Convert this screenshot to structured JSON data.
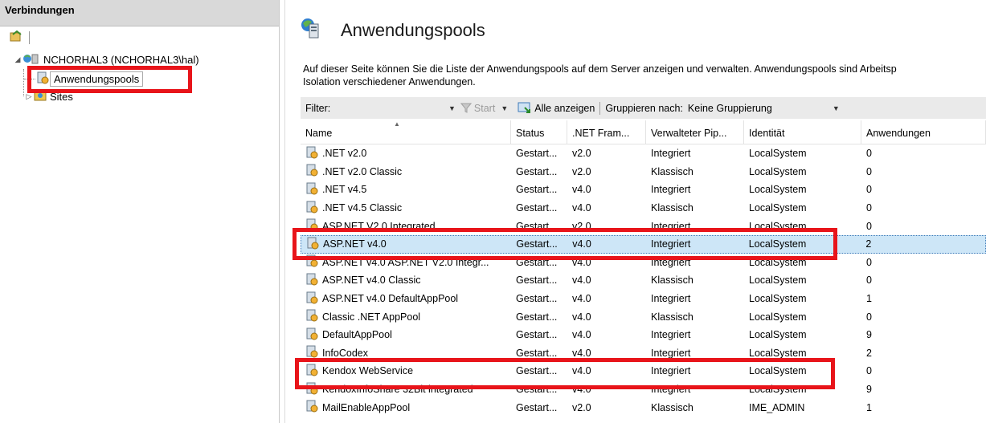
{
  "connections": {
    "header": "Verbindungen",
    "tree": {
      "server_label": "NCHORHAL3 (NCHORHAL3\\hal)",
      "app_pools_label": "Anwendungspools",
      "sites_label": "Sites"
    }
  },
  "page": {
    "title": "Anwendungspools",
    "description": "Auf dieser Seite können Sie die Liste der Anwendungspools auf dem Server anzeigen und verwalten. Anwendungspools sind Arbeitsp\nIsolation verschiedener Anwendungen."
  },
  "filterbar": {
    "filter_label": "Filter:",
    "start_label": "Start",
    "show_all_label": "Alle anzeigen",
    "group_by_label": "Gruppieren nach:",
    "group_by_value": "Keine Gruppierung"
  },
  "grid": {
    "columns": [
      "Name",
      "Status",
      ".NET Fram...",
      "Verwalteter Pip...",
      "Identität",
      "Anwendungen"
    ],
    "rows": [
      {
        "name": ".NET v2.0",
        "status": "Gestart...",
        "net": "v2.0",
        "pipeline": "Integriert",
        "identity": "LocalSystem",
        "apps": "0"
      },
      {
        "name": ".NET v2.0 Classic",
        "status": "Gestart...",
        "net": "v2.0",
        "pipeline": "Klassisch",
        "identity": "LocalSystem",
        "apps": "0"
      },
      {
        "name": ".NET v4.5",
        "status": "Gestart...",
        "net": "v4.0",
        "pipeline": "Integriert",
        "identity": "LocalSystem",
        "apps": "0"
      },
      {
        "name": ".NET v4.5 Classic",
        "status": "Gestart...",
        "net": "v4.0",
        "pipeline": "Klassisch",
        "identity": "LocalSystem",
        "apps": "0"
      },
      {
        "name": "ASP.NET V2.0 Integrated",
        "status": "Gestart...",
        "net": "v2.0",
        "pipeline": "Integriert",
        "identity": "LocalSystem",
        "apps": "0"
      },
      {
        "name": "ASP.NET v4.0",
        "status": "Gestart...",
        "net": "v4.0",
        "pipeline": "Integriert",
        "identity": "LocalSystem",
        "apps": "2"
      },
      {
        "name": "ASP.NET v4.0 ASP.NET V2.0 Integr...",
        "status": "Gestart...",
        "net": "v4.0",
        "pipeline": "Integriert",
        "identity": "LocalSystem",
        "apps": "0"
      },
      {
        "name": "ASP.NET v4.0 Classic",
        "status": "Gestart...",
        "net": "v4.0",
        "pipeline": "Klassisch",
        "identity": "LocalSystem",
        "apps": "0"
      },
      {
        "name": "ASP.NET v4.0 DefaultAppPool",
        "status": "Gestart...",
        "net": "v4.0",
        "pipeline": "Integriert",
        "identity": "LocalSystem",
        "apps": "1"
      },
      {
        "name": "Classic .NET AppPool",
        "status": "Gestart...",
        "net": "v4.0",
        "pipeline": "Klassisch",
        "identity": "LocalSystem",
        "apps": "0"
      },
      {
        "name": "DefaultAppPool",
        "status": "Gestart...",
        "net": "v4.0",
        "pipeline": "Integriert",
        "identity": "LocalSystem",
        "apps": "9"
      },
      {
        "name": "InfoCodex",
        "status": "Gestart...",
        "net": "v4.0",
        "pipeline": "Integriert",
        "identity": "LocalSystem",
        "apps": "2"
      },
      {
        "name": "Kendox WebService",
        "status": "Gestart...",
        "net": "v4.0",
        "pipeline": "Integriert",
        "identity": "LocalSystem",
        "apps": "0"
      },
      {
        "name": "KendoxInfoShare 32Bit integrated",
        "status": "Gestart...",
        "net": "v4.0",
        "pipeline": "Integriert",
        "identity": "LocalSystem",
        "apps": "9"
      },
      {
        "name": "MailEnableAppPool",
        "status": "Gestart...",
        "net": "v2.0",
        "pipeline": "Klassisch",
        "identity": "IME_ADMIN",
        "apps": "1"
      }
    ],
    "selected_row": "ASP.NET v4.0"
  },
  "colors": {
    "highlight": "#e8141a",
    "selection": "#cde6f7"
  }
}
